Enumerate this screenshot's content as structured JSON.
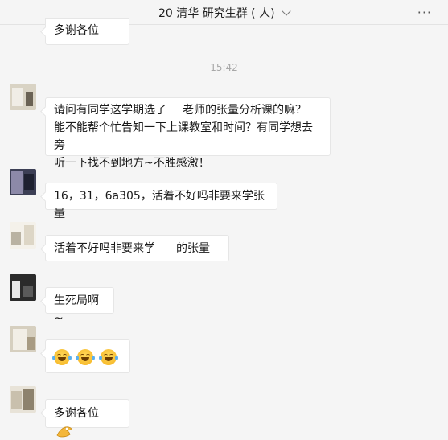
{
  "header": {
    "title": "20 清华 研究生群 (  人)",
    "more_icon": "ellipsis-icon"
  },
  "timestamp": "15:42",
  "messages": [
    {
      "nickname": "",
      "text": "多谢各位"
    },
    {
      "nickname": "",
      "line1": "请问有同学这学期选了",
      "line1b": "老师的张量分析课的嘛？",
      "line2": "能不能帮个忙告知一下上课教室和时间？有同学想去旁",
      "line3": "听一下找不到地方~不胜感激！"
    },
    {
      "nickname": "",
      "text": "16，31，6a305，活着不好吗非要来学张量"
    },
    {
      "nickname": "",
      "text": "活着不好吗非要来学",
      "text_tail": "的张量"
    },
    {
      "nickname": "",
      "text": "生死局啊~"
    },
    {
      "nickname": "",
      "emoji": "tears-of-joy-emoji"
    },
    {
      "nickname": "",
      "text": "多谢各位",
      "emoji": "ok-hand-emoji"
    }
  ],
  "colors": {
    "background": "#f5f5f5",
    "bubble": "#ffffff",
    "timestamp": "#a8a8a8",
    "emoji_yellow": "#f7b92a"
  }
}
